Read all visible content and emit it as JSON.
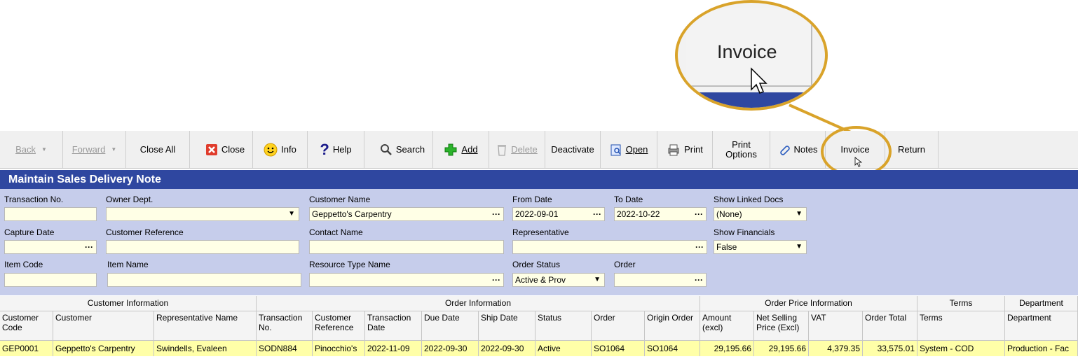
{
  "callout": {
    "label": "Invoice"
  },
  "toolbar": {
    "back": "Back",
    "forward": "Forward",
    "close_all": "Close All",
    "close": "Close",
    "info": "Info",
    "help": "Help",
    "search": "Search",
    "add": "Add",
    "delete": "Delete",
    "deactivate": "Deactivate",
    "open": "Open",
    "print": "Print",
    "print_options_1": "Print",
    "print_options_2": "Options",
    "notes": "Notes",
    "invoice": "Invoice",
    "return": "Return"
  },
  "title": "Maintain Sales Delivery Note",
  "filters": {
    "transaction_no": {
      "label": "Transaction No.",
      "value": ""
    },
    "owner_dept": {
      "label": "Owner Dept.",
      "value": ""
    },
    "customer_name": {
      "label": "Customer Name",
      "value": "Geppetto's Carpentry"
    },
    "from_date": {
      "label": "From Date",
      "value": "2022-09-01"
    },
    "to_date": {
      "label": "To Date",
      "value": "2022-10-22"
    },
    "show_linked_docs": {
      "label": "Show Linked Docs",
      "value": "(None)"
    },
    "capture_date": {
      "label": "Capture Date",
      "value": ""
    },
    "customer_reference": {
      "label": "Customer Reference",
      "value": ""
    },
    "contact_name": {
      "label": "Contact Name",
      "value": ""
    },
    "representative": {
      "label": "Representative",
      "value": ""
    },
    "show_financials": {
      "label": "Show Financials",
      "value": "False"
    },
    "item_code": {
      "label": "Item Code",
      "value": ""
    },
    "item_name": {
      "label": "Item Name",
      "value": ""
    },
    "resource_type_name": {
      "label": "Resource Type Name",
      "value": ""
    },
    "order_status": {
      "label": "Order Status",
      "value": "Active & Prov"
    },
    "order": {
      "label": "Order",
      "value": ""
    }
  },
  "grid": {
    "groups": [
      "Customer Information",
      "Order Information",
      "Order Price Information",
      "Terms",
      "Department"
    ],
    "columns": [
      "Customer Code",
      "Customer",
      "Representative Name",
      "Transaction No.",
      "Customer Reference",
      "Transaction Date",
      "Due Date",
      "Ship Date",
      "Status",
      "Order",
      "Origin Order",
      "Amount (excl)",
      "Net Selling Price (Excl)",
      "VAT",
      "Order Total",
      "Terms",
      "Department"
    ],
    "rows": [
      [
        "GEP0001",
        "Geppetto's Carpentry",
        "Swindells, Evaleen",
        "SODN884",
        "Pinocchio's",
        "2022-11-09 ",
        "2022-09-30 ",
        "2022-09-30",
        "Active",
        "SO1064",
        "SO1064",
        "29,195.66",
        "29,195.66",
        "4,379.35",
        "33,575.01",
        "System - COD",
        "Production - Fac"
      ]
    ]
  },
  "colors": {
    "accent": "#2f47a0",
    "panel": "#c6cdeb",
    "highlight": "#d9a32a",
    "row": "#ffffa8"
  }
}
